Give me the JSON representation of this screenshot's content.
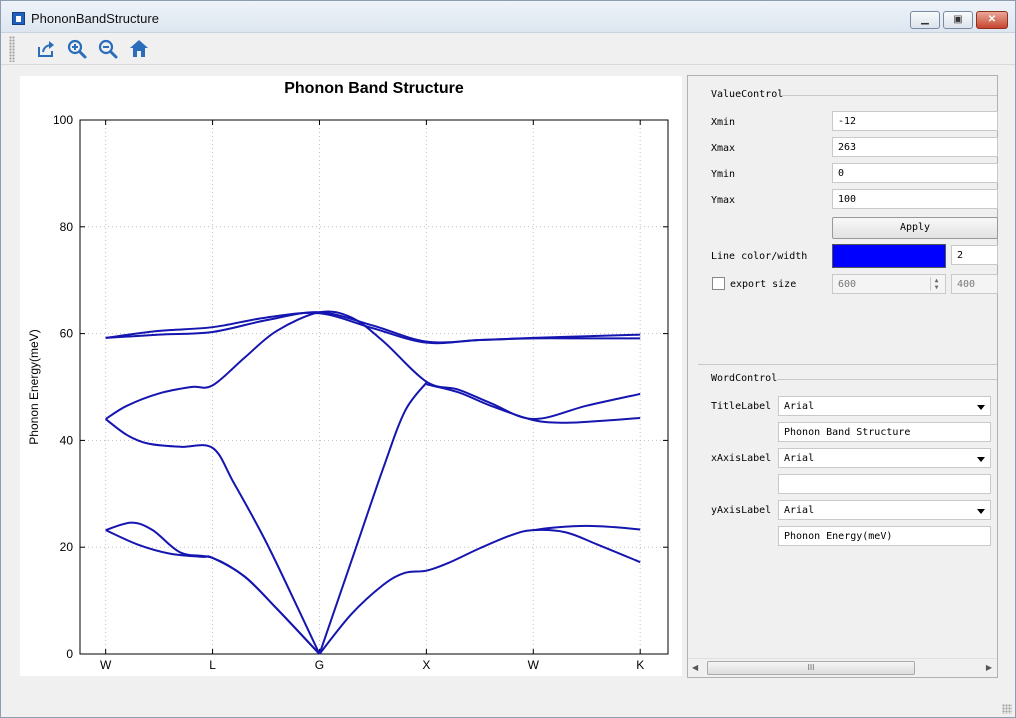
{
  "window": {
    "title": "PhononBandStructure",
    "controls": [
      "minimize",
      "maximize",
      "close"
    ]
  },
  "toolbar": {
    "icons": [
      "export-icon",
      "zoom-in-icon",
      "zoom-out-icon",
      "home-icon"
    ]
  },
  "colors": {
    "line": "#0000ff",
    "curve": "#1515b0",
    "grid": "#c0c0c0"
  },
  "chart_data": {
    "type": "line",
    "title": "Phonon Band Structure",
    "xlabel": "",
    "ylabel": "Phonon Energy(meV)",
    "xlim": [
      -12,
      263
    ],
    "ylim": [
      0,
      100
    ],
    "yticks": [
      0,
      20,
      40,
      60,
      80,
      100
    ],
    "xticks": [
      {
        "x": 0,
        "label": "W"
      },
      {
        "x": 50,
        "label": "L"
      },
      {
        "x": 100,
        "label": "G"
      },
      {
        "x": 150,
        "label": "X"
      },
      {
        "x": 200,
        "label": "W"
      },
      {
        "x": 250,
        "label": "K"
      }
    ],
    "grid": true,
    "line_width": 2,
    "series": [
      {
        "x": [
          0,
          25,
          50,
          75,
          100,
          125,
          150,
          175,
          200,
          225,
          250
        ],
        "y": [
          59.2,
          59.8,
          60.3,
          62.5,
          64.0,
          61.5,
          58.5,
          58.8,
          59.2,
          59.5,
          59.8
        ]
      },
      {
        "x": [
          0,
          25,
          50,
          75,
          100,
          125,
          150,
          175,
          200,
          225,
          250
        ],
        "y": [
          59.2,
          60.5,
          61.2,
          63.0,
          63.8,
          61.0,
          58.3,
          58.8,
          59.1,
          59.1,
          59.1
        ]
      },
      {
        "x": [
          0,
          10,
          25,
          40,
          50,
          65,
          80,
          100,
          115,
          130,
          150,
          165,
          180,
          200,
          225,
          250
        ],
        "y": [
          44.0,
          46.5,
          48.8,
          50.0,
          50.3,
          55.5,
          60.5,
          64.0,
          63.0,
          58.5,
          51.0,
          49.5,
          47.0,
          44.0,
          46.5,
          48.7
        ]
      },
      {
        "x": [
          150,
          165,
          180,
          200,
          215,
          230,
          250
        ],
        "y": [
          50.5,
          49.0,
          46.5,
          43.8,
          43.3,
          43.6,
          44.2
        ]
      },
      {
        "x": [
          0,
          10,
          20,
          35,
          50,
          60,
          75,
          90,
          100
        ],
        "y": [
          44.0,
          41.0,
          39.4,
          38.8,
          38.6,
          32.0,
          21.0,
          8.5,
          0.0
        ]
      },
      {
        "x": [
          100,
          115,
          130,
          140,
          150
        ],
        "y": [
          0.0,
          17.5,
          35.0,
          45.5,
          50.8
        ]
      },
      {
        "x": [
          0,
          12,
          22,
          35,
          50,
          65,
          80,
          100
        ],
        "y": [
          23.2,
          24.6,
          23.2,
          19.0,
          18.0,
          14.5,
          8.5,
          0.0
        ]
      },
      {
        "x": [
          0,
          15,
          30,
          45,
          50,
          65,
          80,
          100
        ],
        "y": [
          23.2,
          20.5,
          18.8,
          18.2,
          18.0,
          14.5,
          8.5,
          0.0
        ]
      },
      {
        "x": [
          100,
          115,
          130,
          140,
          150,
          160,
          175,
          190,
          200,
          215,
          230,
          250
        ],
        "y": [
          0.0,
          7.5,
          13.0,
          15.2,
          15.6,
          17.0,
          19.8,
          22.3,
          23.2,
          22.8,
          20.5,
          17.2
        ]
      },
      {
        "x": [
          200,
          210,
          225,
          240,
          250
        ],
        "y": [
          23.2,
          23.7,
          24.0,
          23.7,
          23.3
        ]
      }
    ]
  },
  "value_control": {
    "title": "ValueControl",
    "xmin_label": "Xmin",
    "xmin": "-12",
    "xmax_label": "Xmax",
    "xmax": "263",
    "ymin_label": "Ymin",
    "ymin": "0",
    "ymax_label": "Ymax",
    "ymax": "100",
    "apply": "Apply",
    "line_label": "Line color/width",
    "line_width": "2",
    "export_label": "export size",
    "export_w": "600",
    "export_h": "400"
  },
  "word_control": {
    "title": "WordControl",
    "title_label": "TitleLabel",
    "title_font": "Arial",
    "title_text": "Phonon Band Structure",
    "xaxis_label": "xAxisLabel",
    "xaxis_font": "Arial",
    "xaxis_text": "",
    "yaxis_label": "yAxisLabel",
    "yaxis_font": "Arial",
    "yaxis_text": "Phonon Energy(meV)"
  },
  "scrollbar": {
    "thumb": "III"
  }
}
